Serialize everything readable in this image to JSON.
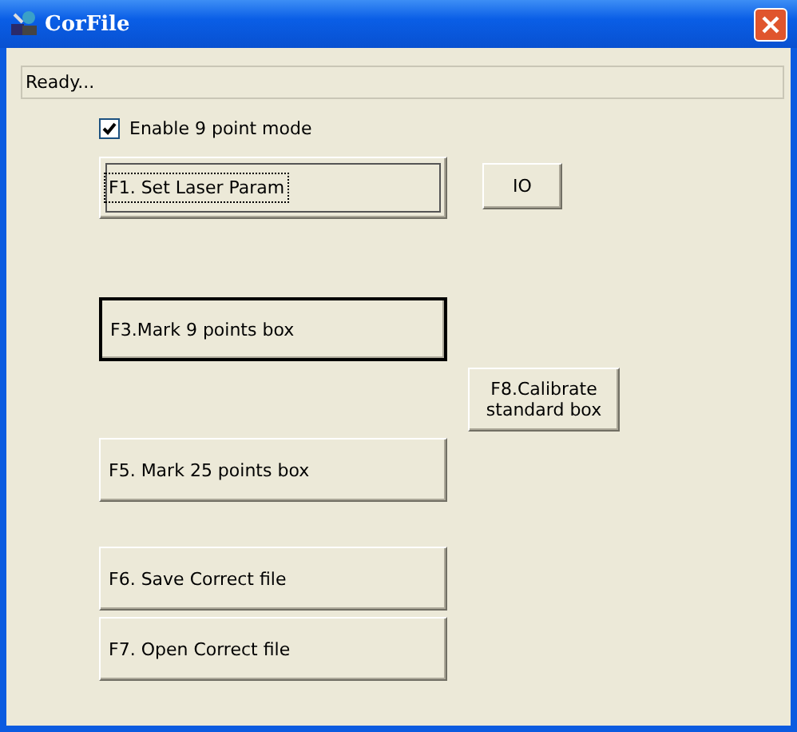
{
  "window": {
    "title": "CorFile"
  },
  "status_field": {
    "value": "Ready..."
  },
  "checkbox": {
    "label": "Enable 9 point mode",
    "checked": true
  },
  "buttons": [
    {
      "label": "F1. Set Laser Param",
      "focused": true,
      "default": false
    },
    {
      "label": "IO",
      "focused": false,
      "default": false
    },
    {
      "label": "F3.Mark 9 points box",
      "focused": false,
      "default": true
    },
    {
      "label": "F8.Calibrate standard box",
      "focused": false,
      "default": false
    },
    {
      "label": "F5. Mark 25 points box",
      "focused": false,
      "default": false
    },
    {
      "label": "F6. Save Correct file",
      "focused": false,
      "default": false
    },
    {
      "label": "F7. Open Correct file",
      "focused": false,
      "default": false
    }
  ]
}
